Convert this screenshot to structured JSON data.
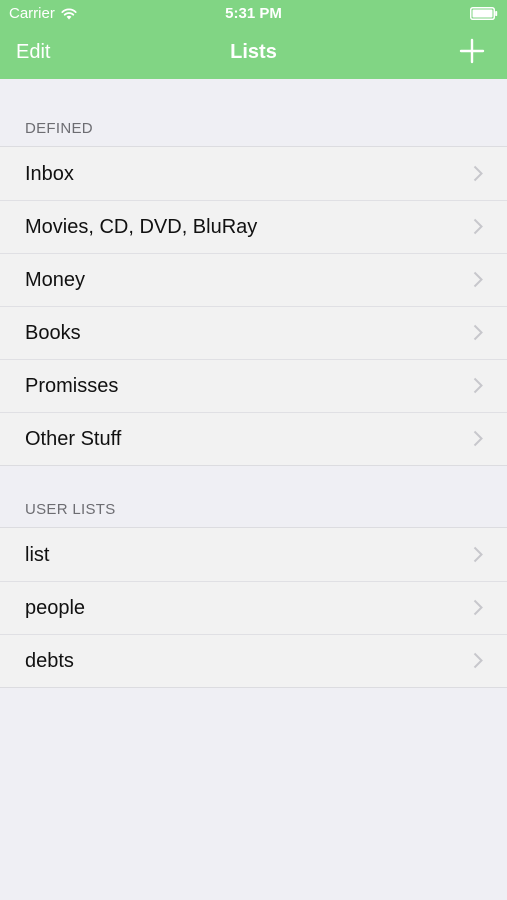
{
  "status_bar": {
    "carrier": "Carrier",
    "time": "5:31 PM",
    "wifi_icon": "wifi-icon",
    "battery_icon": "battery-icon"
  },
  "nav": {
    "edit_label": "Edit",
    "title": "Lists",
    "add_icon": "plus-icon"
  },
  "sections": [
    {
      "header": "DEFINED",
      "items": [
        {
          "label": "Inbox"
        },
        {
          "label": "Movies, CD, DVD, BluRay"
        },
        {
          "label": "Money"
        },
        {
          "label": "Books"
        },
        {
          "label": "Promisses"
        },
        {
          "label": "Other Stuff"
        }
      ]
    },
    {
      "header": "USER LISTS",
      "items": [
        {
          "label": "list"
        },
        {
          "label": "people"
        },
        {
          "label": "debts"
        }
      ]
    }
  ],
  "colors": {
    "accent": "#81d584",
    "background": "#efeff4",
    "row_background": "#f2f2f2",
    "section_text": "#6d6d72",
    "chevron": "#c7c7cc"
  }
}
